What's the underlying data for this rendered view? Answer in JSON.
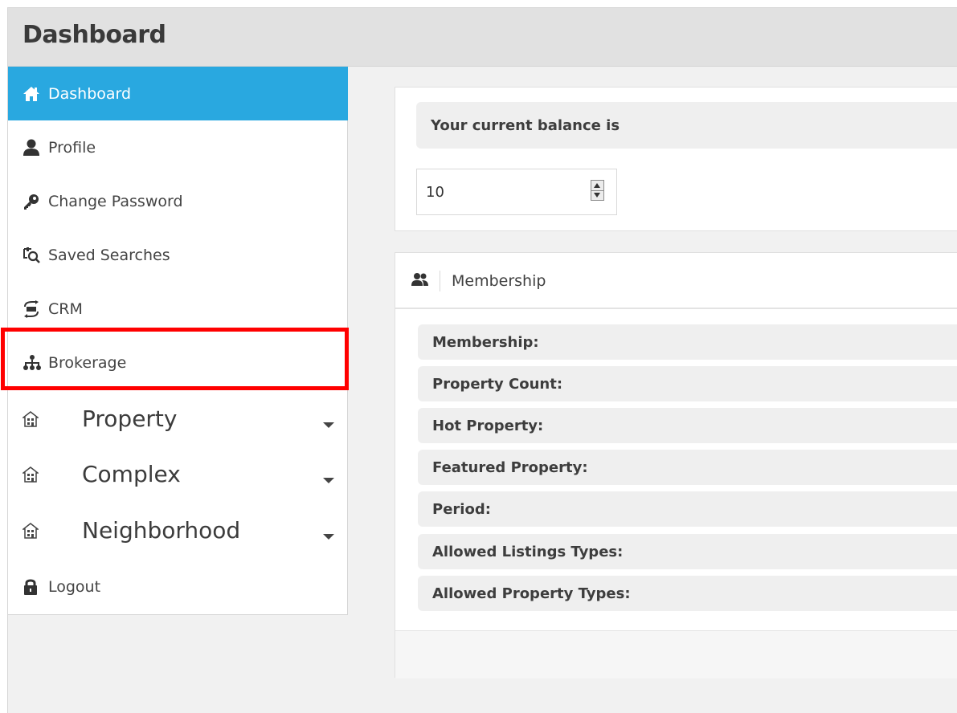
{
  "page": {
    "title": "Dashboard"
  },
  "sidebar": {
    "items": [
      {
        "label": "Dashboard",
        "icon": "home-icon",
        "active": true
      },
      {
        "label": "Profile",
        "icon": "user-icon"
      },
      {
        "label": "Change Password",
        "icon": "key-icon"
      },
      {
        "label": "Saved Searches",
        "icon": "saved-search-icon"
      },
      {
        "label": "CRM",
        "icon": "crm-icon"
      },
      {
        "label": "Brokerage",
        "icon": "sitemap-icon",
        "highlighted": true
      },
      {
        "label": "Property",
        "icon": "building-icon",
        "expandable": true
      },
      {
        "label": "Complex",
        "icon": "building-icon",
        "expandable": true
      },
      {
        "label": "Neighborhood",
        "icon": "building-icon",
        "expandable": true
      },
      {
        "label": "Logout",
        "icon": "lock-icon"
      }
    ]
  },
  "balance": {
    "label": "Your current balance is",
    "value": "10"
  },
  "membership": {
    "title": "Membership",
    "icon": "users-icon",
    "rows": [
      "Membership:",
      "Property Count:",
      "Hot Property:",
      "Featured Property:",
      "Period:",
      "Allowed Listings Types:",
      "Allowed Property Types:"
    ]
  },
  "colors": {
    "accent": "#29a8e0",
    "highlight": "#ff0000",
    "header_bg": "#e1e1e1",
    "page_bg": "#f1f1f1"
  }
}
